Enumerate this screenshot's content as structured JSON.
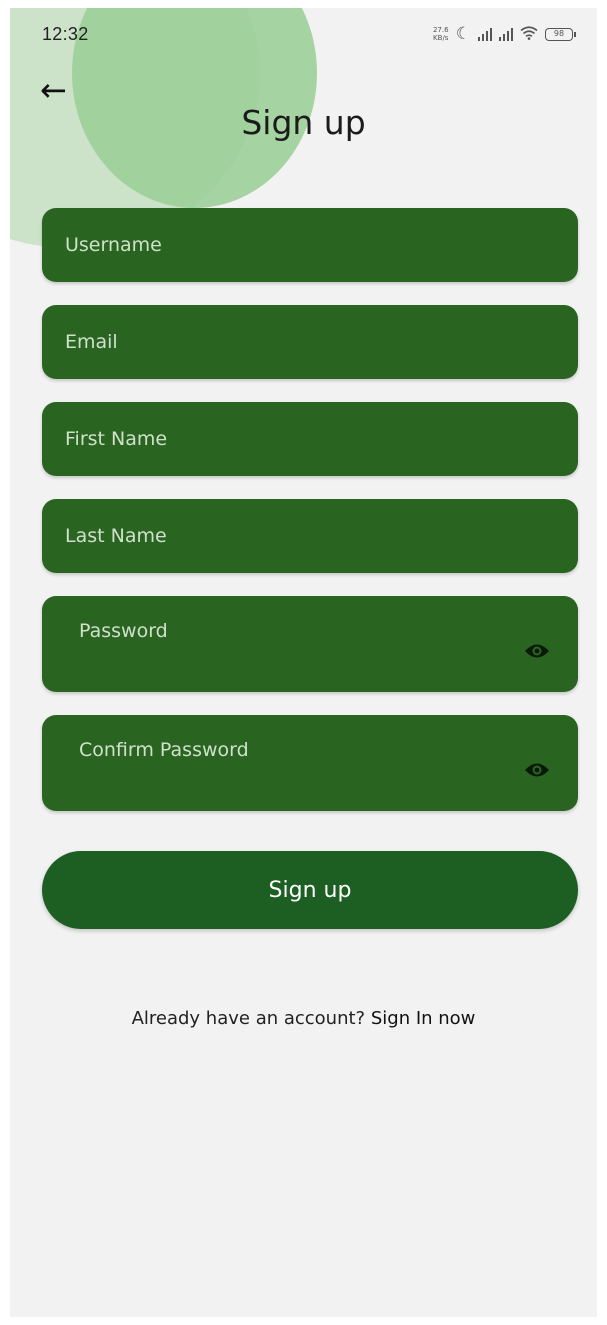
{
  "status_bar": {
    "time": "12:32",
    "net_speed": "27.6 KB/s",
    "battery": "98"
  },
  "header": {
    "title": "Sign up"
  },
  "form": {
    "username_placeholder": "Username",
    "email_placeholder": "Email",
    "first_name_placeholder": "First Name",
    "last_name_placeholder": "Last Name",
    "password_placeholder": "Password",
    "confirm_password_placeholder": "Confirm Password"
  },
  "actions": {
    "signup_label": "Sign up"
  },
  "footer": {
    "prompt": "Already have an account? ",
    "link": "Sign In now"
  },
  "icons": {
    "back": "arrow-left-icon",
    "eye": "eye-icon"
  },
  "colors": {
    "field_bg": "#2a6421",
    "button_bg": "#1d5e22",
    "circle_light": "#c9e2c6",
    "circle_mid": "#9ccf98",
    "page_bg": "#f2f2f2"
  }
}
